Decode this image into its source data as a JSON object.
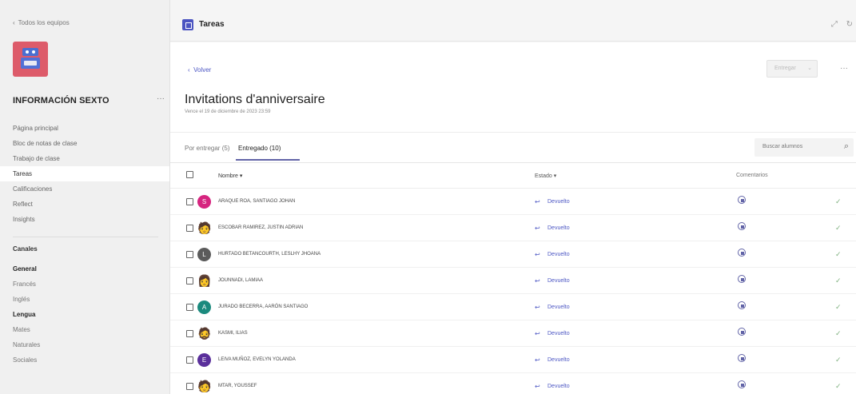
{
  "sidebar": {
    "back_all": "Todos los equipos",
    "team_name": "INFORMACIÓN SEXTO",
    "more": "···",
    "nav": [
      "Página principal",
      "Bloc de notas de clase",
      "Trabajo de clase",
      "Tareas",
      "Calificaciones",
      "Reflect",
      "Insights"
    ],
    "active_nav": "Tareas",
    "channels_title": "Canales",
    "channels": [
      {
        "label": "General",
        "bold": true
      },
      {
        "label": "Francés",
        "bold": false
      },
      {
        "label": "Inglés",
        "bold": false
      },
      {
        "label": "Lengua",
        "bold": true
      },
      {
        "label": "Mates",
        "bold": false
      },
      {
        "label": "Naturales",
        "bold": false
      },
      {
        "label": "Sociales",
        "bold": false
      }
    ]
  },
  "topbar": {
    "title": "Tareas",
    "expand_icon": "⤢",
    "refresh_icon": "↻"
  },
  "main": {
    "back": "Volver",
    "submit": "Entregar",
    "more": "···",
    "title": "Invitations d'anniversaire",
    "due": "Vence el 19 de diciembre de 2023 23:59",
    "tabs": [
      {
        "label": "Por entregar (5)",
        "active": false
      },
      {
        "label": "Entregado (10)",
        "active": true
      }
    ],
    "search_placeholder": "Buscar alumnos"
  },
  "table": {
    "headers": {
      "name": "Nombre ▾",
      "status": "Estado ▾",
      "comments": "Comentarios"
    },
    "rows": [
      {
        "name": "ARAQUE ROA, SANTIAGO JOHAN",
        "initial": "S",
        "color": "#d6247f",
        "status": "Devuelto"
      },
      {
        "name": "ESCOBAR RAMIREZ, JUSTIN ADRIAN",
        "initial": "🧑",
        "color": "transparent",
        "status": "Devuelto"
      },
      {
        "name": "HURTADO BETANCOURTH, LESLHY JHOANA",
        "initial": "L",
        "color": "#5b5b5b",
        "status": "Devuelto"
      },
      {
        "name": "JOUNNADI, LAMIAA",
        "initial": "👩",
        "color": "transparent",
        "status": "Devuelto"
      },
      {
        "name": "JURADO BECERRA, AARÓN SANTIAGO",
        "initial": "A",
        "color": "#1b8a7e",
        "status": "Devuelto"
      },
      {
        "name": "KASMI, ILIAS",
        "initial": "🧔",
        "color": "transparent",
        "status": "Devuelto"
      },
      {
        "name": "LEIVA MUÑOZ, EVELYN YOLANDA",
        "initial": "E",
        "color": "#5a2f9b",
        "status": "Devuelto"
      },
      {
        "name": "MTAR, YOUSSEF",
        "initial": "🧑",
        "color": "transparent",
        "status": "Devuelto"
      }
    ]
  }
}
